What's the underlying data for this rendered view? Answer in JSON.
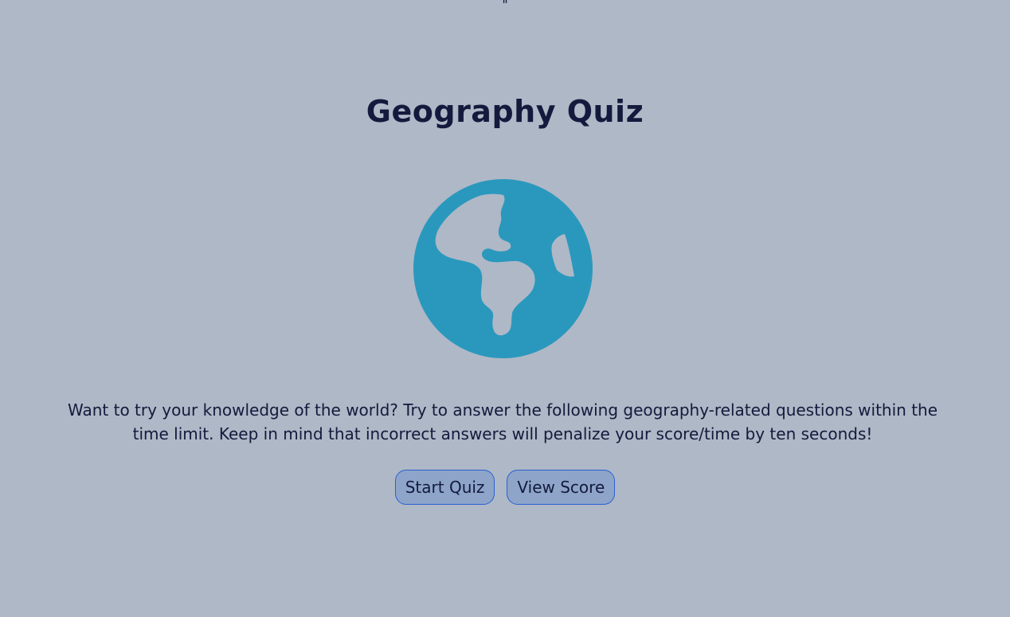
{
  "header": {
    "stray_text": "\""
  },
  "main": {
    "title": "Geography Quiz",
    "icon": "globe-icon",
    "icon_color": "#2a98bd",
    "description": "Want to try your knowledge of the world? Try to answer the following geography-related questions within the time limit. Keep in mind that incorrect answers will penalize your score/time by ten seconds!"
  },
  "buttons": {
    "start_label": "Start Quiz",
    "view_score_label": "View Score"
  },
  "colors": {
    "background": "#afb8c6",
    "text": "#131a3d",
    "button_fill": "#8ea5c9",
    "button_border": "#2a5fd6"
  }
}
